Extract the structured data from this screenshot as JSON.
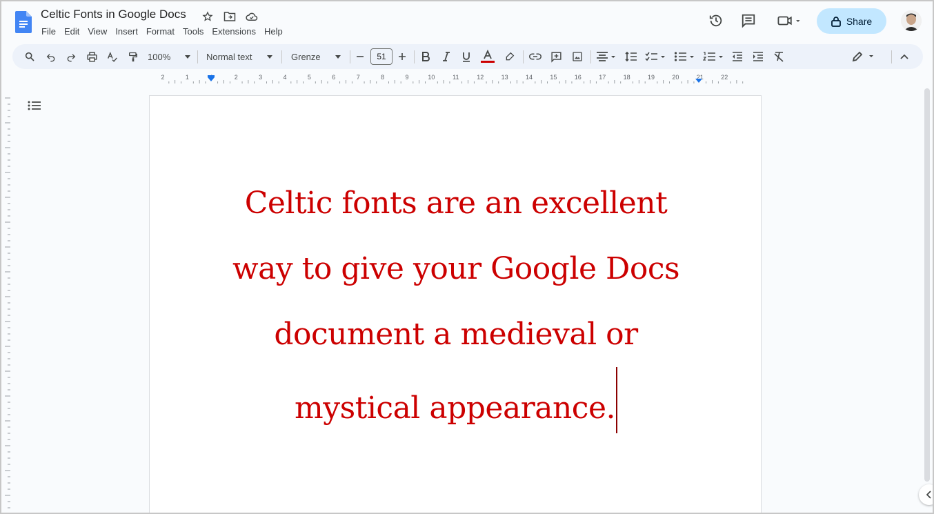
{
  "doc": {
    "title": "Celtic Fonts in Google Docs",
    "body_lines": [
      "Celtic fonts are an excellent",
      "way to give your Google Docs",
      "document a medieval or",
      "mystical appearance."
    ],
    "text_color": "#cc0000"
  },
  "menu": [
    "File",
    "Edit",
    "View",
    "Insert",
    "Format",
    "Tools",
    "Extensions",
    "Help"
  ],
  "header": {
    "share_label": "Share"
  },
  "toolbar": {
    "zoom": "100%",
    "style": "Normal text",
    "font": "Grenze",
    "font_size": "51"
  },
  "ruler": {
    "labels": [
      "2",
      "1",
      "1",
      "2",
      "3",
      "4",
      "5",
      "6",
      "7",
      "8",
      "9",
      "10",
      "11",
      "12",
      "13",
      "14",
      "15",
      "16",
      "17",
      "18",
      "19",
      "20",
      "21",
      "22"
    ]
  },
  "icons": {
    "accent": "#0b57d0",
    "share_bg": "#c2e7ff"
  }
}
